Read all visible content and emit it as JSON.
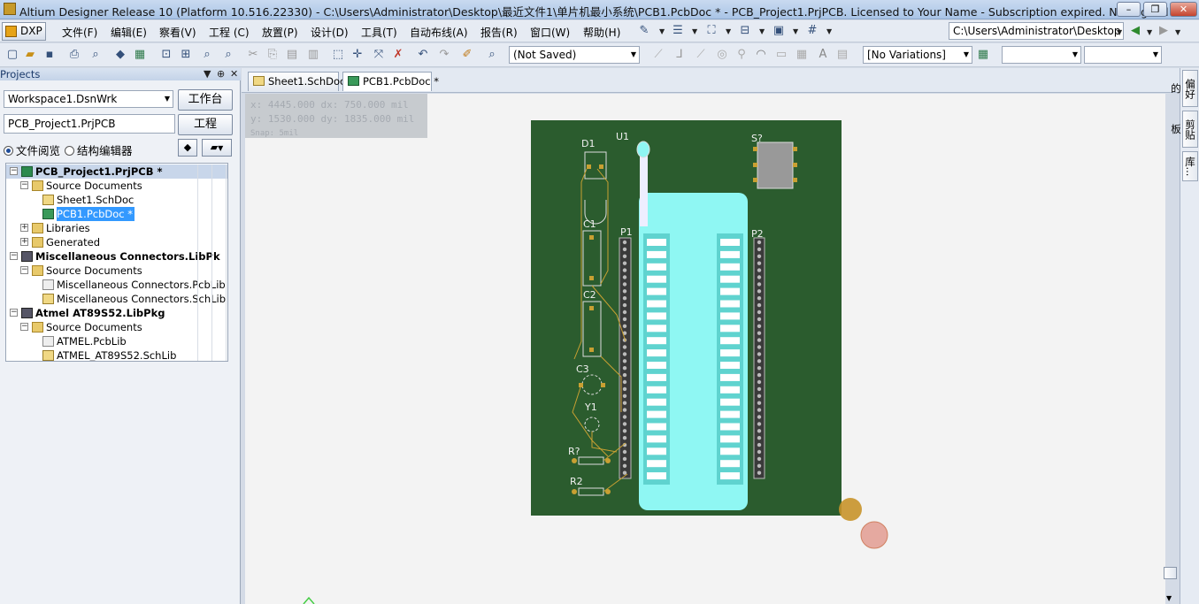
{
  "window": {
    "title": "Altium Designer Release 10 (Platform 10.516.22330) - C:\\Users\\Administrator\\Desktop\\最近文件1\\单片机最小系统\\PCB1.PcbDoc * - PCB_Project1.PrjPCB. Licensed to Your Name - Subscription expired. Not signed in.",
    "min": "–",
    "max": "❐",
    "close": "✕"
  },
  "menubar": {
    "dxp": "DXP",
    "items": [
      "文件(F)",
      "编辑(E)",
      "察看(V)",
      "工程 (C)",
      "放置(P)",
      "设计(D)",
      "工具(T)",
      "自动布线(A)",
      "报告(R)",
      "窗口(W)",
      "帮助(H)"
    ],
    "path": "C:\\Users\\Administrator\\Desktop"
  },
  "toolbar": {
    "saved_state": "(Not Saved)",
    "variations": "[No Variations]"
  },
  "projects_panel": {
    "title": "Projects",
    "workspace": "Workspace1.DsnWrk",
    "workspace_btn": "工作台",
    "project": "PCB_Project1.PrjPCB",
    "project_btn": "工程",
    "radio_file": "文件阅览",
    "radio_struct": "结构编辑器",
    "tree": [
      {
        "label": "PCB_Project1.PrjPCB *",
        "level": 0,
        "exp": "−",
        "icon": "ico-pcbproj",
        "bold": true,
        "state": "projsel"
      },
      {
        "label": "Source Documents",
        "level": 1,
        "exp": "−",
        "icon": "ico-folder"
      },
      {
        "label": "Sheet1.SchDoc",
        "level": 2,
        "icon": "ico-sch"
      },
      {
        "label": "PCB1.PcbDoc *",
        "level": 2,
        "icon": "ico-pcb",
        "state": "sel"
      },
      {
        "label": "Libraries",
        "level": 1,
        "exp": "+",
        "icon": "ico-folder"
      },
      {
        "label": "Generated",
        "level": 1,
        "exp": "+",
        "icon": "ico-folder"
      },
      {
        "label": "Miscellaneous Connectors.LibPk",
        "level": 0,
        "exp": "−",
        "icon": "ico-pkg",
        "bold": true
      },
      {
        "label": "Source Documents",
        "level": 1,
        "exp": "−",
        "icon": "ico-folder"
      },
      {
        "label": "Miscellaneous Connectors.PcbLib",
        "level": 2,
        "icon": "ico-lib"
      },
      {
        "label": "Miscellaneous Connectors.SchLib",
        "level": 2,
        "icon": "ico-sch"
      },
      {
        "label": "Atmel AT89S52.LibPkg",
        "level": 0,
        "exp": "−",
        "icon": "ico-pkg",
        "bold": true
      },
      {
        "label": "Source Documents",
        "level": 1,
        "exp": "−",
        "icon": "ico-folder"
      },
      {
        "label": "ATMEL.PcbLib",
        "level": 2,
        "icon": "ico-lib"
      },
      {
        "label": "ATMEL_AT89S52.SchLib",
        "level": 2,
        "icon": "ico-sch"
      }
    ]
  },
  "tabs": {
    "sheet": "Sheet1.SchDoc",
    "pcb": "PCB1.PcbDoc *"
  },
  "coords": {
    "x": "x:  4445.000    dx:   750.000  mil",
    "y": "y:  1530.000    dy:  1835.000  mil",
    "snap": "Snap: 5mil"
  },
  "right_panel": {
    "tabs": [
      "偏好的",
      "剪贴板",
      "库..."
    ]
  },
  "pcb": {
    "designators": [
      "D1",
      "U1",
      "S?",
      "C1",
      "C2",
      "C3",
      "Y1",
      "P1",
      "P2",
      "R?",
      "R2"
    ],
    "colors": {
      "board": "#2b5c2e",
      "socket": "#8ff7f3",
      "silk": "#e8e8e8",
      "pad": "#c8a032"
    }
  }
}
